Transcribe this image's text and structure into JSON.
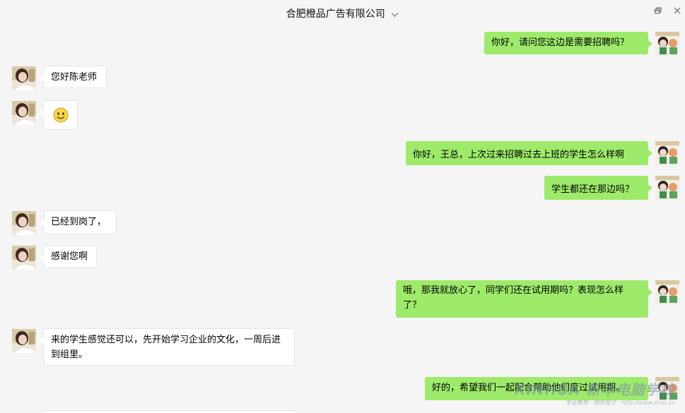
{
  "window": {
    "title": "合肥橙品广告有限公司"
  },
  "messages": [
    {
      "side": "out",
      "text": "你好，请问您这边是需要招聘吗？"
    },
    {
      "side": "in",
      "text": "您好陈老师"
    },
    {
      "side": "in",
      "text": "",
      "emoji": "smile-emoji"
    },
    {
      "side": "out",
      "text": "你好，王总，上次过来招聘过去上班的学生怎么样啊"
    },
    {
      "side": "out",
      "text": "学生都还在那边吗？"
    },
    {
      "side": "in",
      "text": "已经到岗了，"
    },
    {
      "side": "in",
      "text": "感谢您啊"
    },
    {
      "side": "out",
      "text": "哦，那我就放心了，同学们还在试用期吗？表现怎么样了？"
    },
    {
      "side": "in",
      "text": "来的学生感觉还可以，先开始学习企业的文化，一周后进到组里。"
    },
    {
      "side": "out",
      "text": "好的，希望我们一起配合帮助他们度过试用期。"
    }
  ],
  "watermark": {
    "line1": "XINHUA 新华电脑学校",
    "line2": "专业教育 · 铸就英才 · http://www.xhxt.cn"
  },
  "colors": {
    "outgoing_bubble": "#9eea6a",
    "incoming_bubble": "#ffffff",
    "background": "#f5f5f5"
  }
}
